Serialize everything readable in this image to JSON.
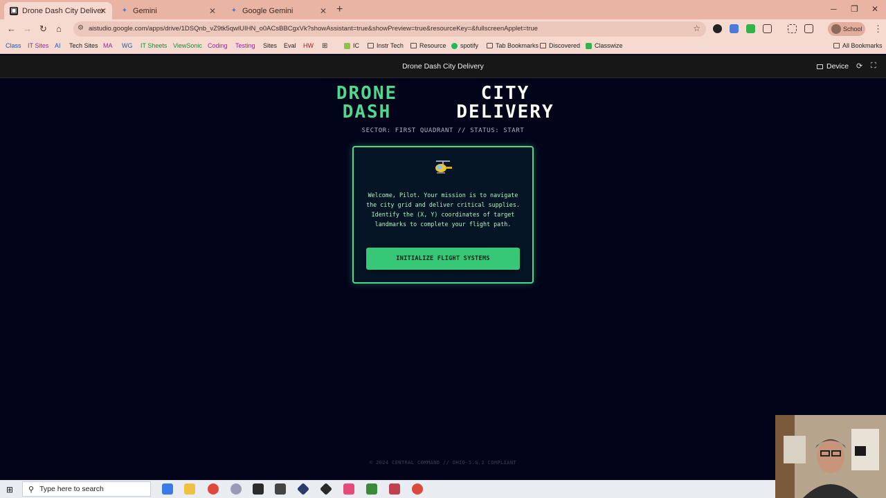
{
  "browser": {
    "tabs": [
      {
        "label": "Drone Dash City Delivery | Goo",
        "active": true
      },
      {
        "label": "Gemini",
        "active": false
      },
      {
        "label": "Google Gemini",
        "active": false
      }
    ],
    "url": "aistudio.google.com/apps/drive/1DSQnb_vZ9tk5qwlUIHN_o0ACsBBCgxVk?showAssistant=true&showPreview=true&resourceKey=&fullscreenApplet=true",
    "profile_label": "School",
    "bookmarks": [
      {
        "label": "Class",
        "color": "#1a55c9"
      },
      {
        "label": "IT Sites",
        "color": "#9b1fa6"
      },
      {
        "label": "AI",
        "color": "#1a55c9"
      },
      {
        "label": "Tech Sites",
        "color": "#222222"
      },
      {
        "label": "MA",
        "color": "#9b1fa6"
      },
      {
        "label": "WG",
        "color": "#1a55c9"
      },
      {
        "label": "IT Sheets",
        "color": "#1e8a3a"
      },
      {
        "label": "ViewSonic",
        "color": "#1e8a3a"
      },
      {
        "label": "Coding",
        "color": "#9b1fa6"
      },
      {
        "label": "Testing",
        "color": "#9b1fa6"
      },
      {
        "label": "Sites",
        "color": "#222222"
      },
      {
        "label": "Eval",
        "color": "#222222"
      },
      {
        "label": "HW",
        "color": "#c0121b"
      },
      {
        "label": "IC",
        "color": "#222222"
      },
      {
        "label": "Instr Tech",
        "color": "#222222"
      },
      {
        "label": "Resource",
        "color": "#222222"
      },
      {
        "label": "spotify",
        "color": "#222222"
      },
      {
        "label": "Tab Bookmarks",
        "color": "#222222"
      },
      {
        "label": "Discovered",
        "color": "#222222"
      },
      {
        "label": "Classwize",
        "color": "#222222"
      },
      {
        "label": "All Bookmarks",
        "color": "#222222"
      }
    ]
  },
  "app_header": {
    "title": "Drone Dash City Delivery",
    "device_label": "Device"
  },
  "game": {
    "title_left_line1": "DRONE",
    "title_left_line2": "DASH",
    "title_right_line1": "CITY",
    "title_right_line2": "DELIVERY",
    "status_line": "SECTOR: FIRST QUADRANT // STATUS: START",
    "welcome_message": "Welcome, Pilot. Your mission is to navigate the city grid and deliver critical supplies. Identify the (X, Y) coordinates of target landmarks to complete your flight path.",
    "start_button": "INITIALIZE FLIGHT SYSTEMS",
    "footer": "© 2024 CENTRAL COMMAND // OHIO-5.G.2 COMPLIANT",
    "accent_color": "#4fd98e"
  },
  "taskbar": {
    "search_placeholder": "Type here to search"
  }
}
